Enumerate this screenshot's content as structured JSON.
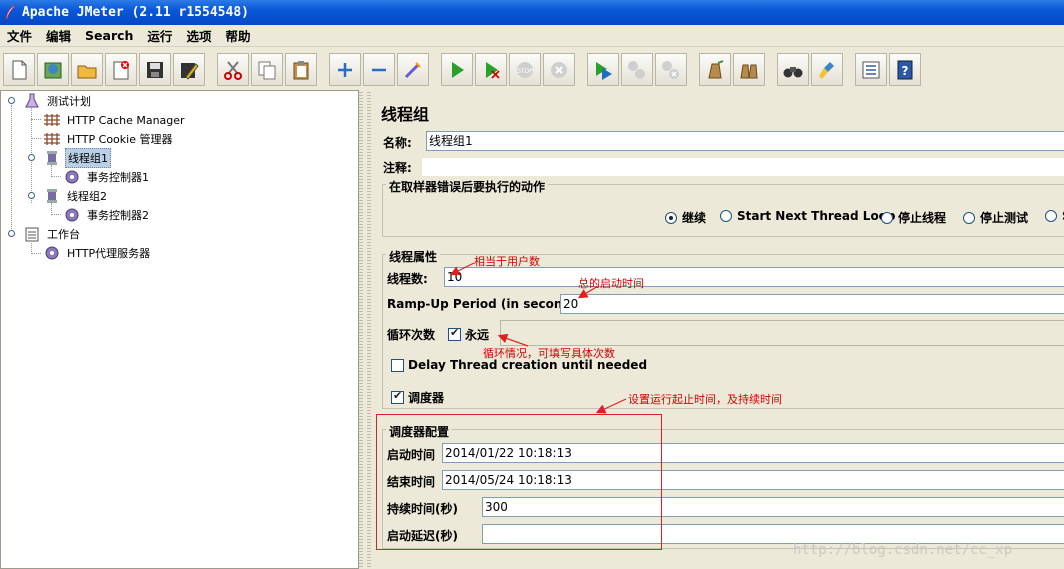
{
  "window": {
    "title": "Apache JMeter (2.11 r1554548)"
  },
  "menu": [
    "文件",
    "编辑",
    "Search",
    "运行",
    "选项",
    "帮助"
  ],
  "toolbar": [
    "new-icon",
    "templates-icon",
    "open-icon",
    "close-icon",
    "save-icon",
    "save-as-icon",
    "cut-icon",
    "copy-icon",
    "paste-icon",
    "expand-icon",
    "collapse-icon",
    "toggle-icon",
    "start-icon",
    "start-no-pause-icon",
    "stop-icon",
    "shutdown-icon",
    "remote-start-icon",
    "remote-stop-icon",
    "remote-shutdown-icon",
    "clear-icon",
    "clear-all-icon",
    "search-icon",
    "reset-search-icon",
    "function-helper-icon",
    "help-icon"
  ],
  "tree": [
    {
      "label": "测试计划"
    },
    {
      "label": "HTTP Cache Manager"
    },
    {
      "label": "HTTP Cookie 管理器"
    },
    {
      "label": "线程组1"
    },
    {
      "label": "事务控制器1"
    },
    {
      "label": "线程组2"
    },
    {
      "label": "事务控制器2"
    },
    {
      "label": "工作台"
    },
    {
      "label": "HTTP代理服务器"
    }
  ],
  "panel": {
    "heading": "线程组",
    "name_label": "名称:",
    "name_value": "线程组1",
    "comment_label": "注释:",
    "comment_value": "",
    "error_action": {
      "title": "在取样器错误后要执行的动作",
      "options": [
        "继续",
        "Start Next Thread Loop",
        "停止线程",
        "停止测试",
        "S"
      ],
      "selected": "继续"
    },
    "thread_props": {
      "title": "线程属性",
      "threads_label": "线程数:",
      "threads_value": "10",
      "rampup_label": "Ramp-Up Period (in seconds):",
      "rampup_value": "20",
      "loop_label": "循环次数",
      "forever_label": "永远",
      "forever_checked": true,
      "loop_value": "",
      "delay_label": "Delay Thread creation until needed",
      "delay_checked": false,
      "scheduler_label": "调度器",
      "scheduler_checked": true
    },
    "scheduler": {
      "title": "调度器配置",
      "start_label": "启动时间",
      "start_value": "2014/01/22 10:18:13",
      "end_label": "结束时间",
      "end_value": "2014/05/24 10:18:13",
      "duration_label": "持续时间(秒)",
      "duration_value": "300",
      "delay_label": "启动延迟(秒)",
      "delay_value": ""
    }
  },
  "annotations": {
    "threads": "相当于用户数",
    "rampup": "总的启动时间",
    "loop": "循环情况，可填写具体次数",
    "scheduler": "设置运行起止时间，及持续时间"
  },
  "watermark": "http://blog.csdn.net/cc_xp",
  "colors": {
    "titlebar": "#0a58d8",
    "annotation": "#d40000",
    "selection": "#b8cfe5"
  }
}
